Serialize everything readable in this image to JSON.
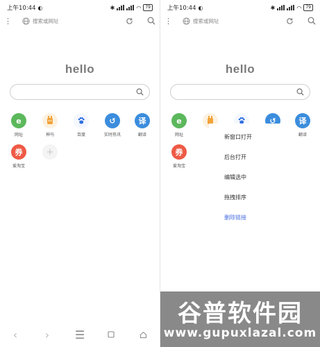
{
  "status": {
    "time": "上午10:44",
    "battery": "79"
  },
  "address_bar": {
    "placeholder": "搜索或网址"
  },
  "home": {
    "title": "hello",
    "shortcuts_row1": [
      {
        "label": "网址",
        "icon": "e-browser-icon",
        "glyph": "e",
        "color": "#5cb85c"
      },
      {
        "label": "神马",
        "icon": "shenma-icon",
        "glyph": "",
        "color": "#f2a33a"
      },
      {
        "label": "百度",
        "icon": "baidu-paw-icon",
        "glyph": "",
        "color": "#2f6fe0"
      },
      {
        "label": "实时热讯",
        "icon": "refresh-news-icon",
        "glyph": "↺",
        "color": "#3b8ddd"
      },
      {
        "label": "翻译",
        "icon": "translate-icon",
        "glyph": "译",
        "color": "#3b8ddd"
      }
    ],
    "shortcuts_row2": [
      {
        "label": "爱淘宝",
        "icon": "taobao-coupon-icon",
        "glyph": "券",
        "color": "#ee5a45"
      },
      {
        "label": "",
        "icon": "add-shortcut-icon",
        "glyph": "+",
        "color": "#f2f2f2"
      }
    ]
  },
  "context_menu": {
    "items": [
      "新窗口打开",
      "后台打开",
      "编辑选中",
      "拖拽排序",
      "删除链接"
    ]
  },
  "watermark": {
    "title": "谷普软件园",
    "url": "www.gupuxlazal.com"
  }
}
